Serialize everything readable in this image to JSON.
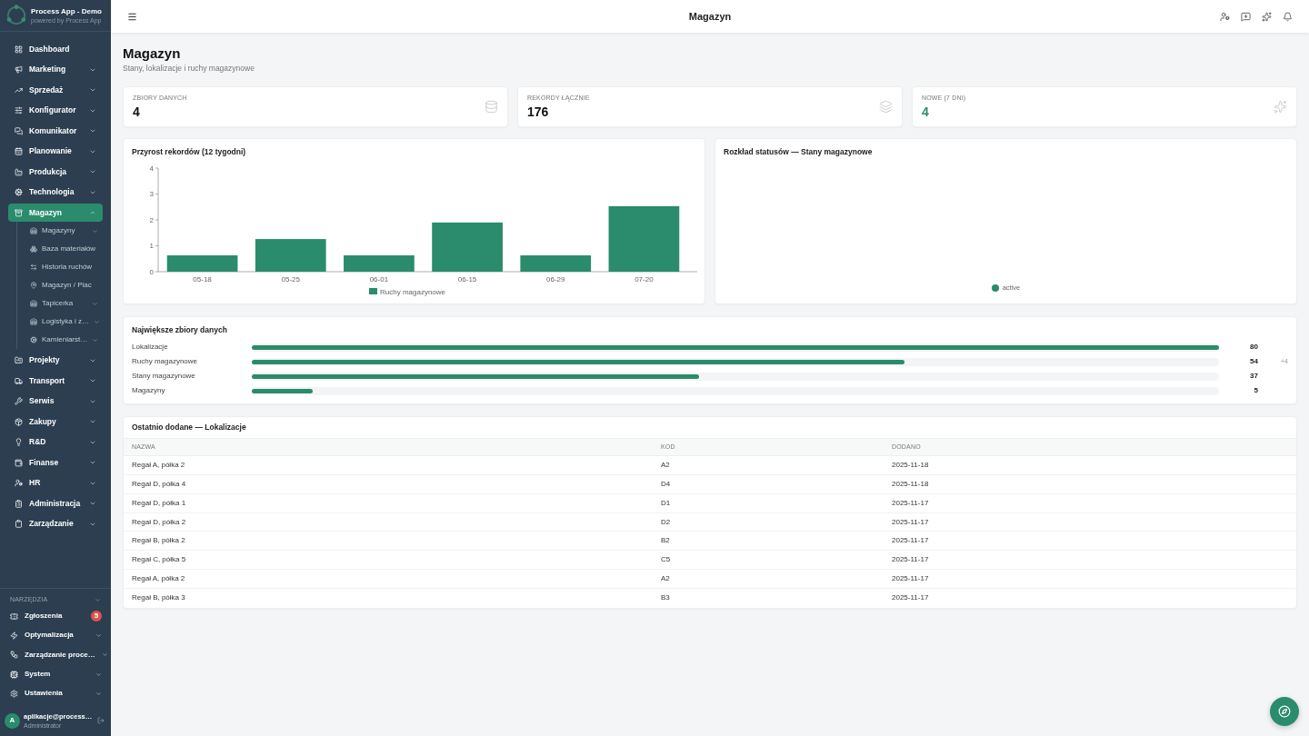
{
  "sidebar": {
    "brand": {
      "title": "Process App - Demo",
      "subtitle": "powered by Process App"
    },
    "items": [
      {
        "label": "Dashboard",
        "kind": "link",
        "selected": false
      },
      {
        "label": "Marketing",
        "kind": "group",
        "expanded": false,
        "selected": false
      },
      {
        "label": "Sprzedaż",
        "kind": "group",
        "expanded": false,
        "selected": false
      },
      {
        "label": "Konfigurator",
        "kind": "group",
        "expanded": false,
        "selected": false
      },
      {
        "label": "Komunikator",
        "kind": "group",
        "expanded": false,
        "selected": false
      },
      {
        "label": "Planowanie",
        "kind": "group",
        "expanded": false,
        "selected": false
      },
      {
        "label": "Produkcja",
        "kind": "group",
        "expanded": false,
        "selected": false
      },
      {
        "label": "Technologia",
        "kind": "group",
        "expanded": false,
        "selected": false
      },
      {
        "label": "Magazyn",
        "kind": "group",
        "expanded": true,
        "selected": true,
        "children": [
          {
            "label": "Magazyny",
            "kind": "group",
            "expanded": false,
            "selected": false
          },
          {
            "label": "Baza materiałów",
            "kind": "link",
            "selected": false
          },
          {
            "label": "Historia ruchów",
            "kind": "link",
            "selected": false
          },
          {
            "label": "Magazyn / Plac",
            "kind": "link",
            "selected": false
          },
          {
            "label": "Tapicerka",
            "kind": "group",
            "expanded": false,
            "selected": false
          },
          {
            "label": "Logistyka i z…",
            "kind": "group",
            "expanded": false,
            "selected": false
          },
          {
            "label": "Kamieniarst…",
            "kind": "group",
            "expanded": false,
            "selected": false
          }
        ]
      },
      {
        "label": "Projekty",
        "kind": "group",
        "expanded": false,
        "selected": false
      },
      {
        "label": "Transport",
        "kind": "group",
        "expanded": false,
        "selected": false
      },
      {
        "label": "Serwis",
        "kind": "group",
        "expanded": false,
        "selected": false
      },
      {
        "label": "Zakupy",
        "kind": "group",
        "expanded": false,
        "selected": false
      },
      {
        "label": "R&D",
        "kind": "group",
        "expanded": false,
        "selected": false
      },
      {
        "label": "Finanse",
        "kind": "group",
        "expanded": false,
        "selected": false
      },
      {
        "label": "HR",
        "kind": "group",
        "expanded": false,
        "selected": false
      },
      {
        "label": "Administracja",
        "kind": "group",
        "expanded": false,
        "selected": false
      },
      {
        "label": "Zarządzanie",
        "kind": "group",
        "expanded": false,
        "selected": false
      }
    ],
    "tools": {
      "title": "NARZĘDZIA",
      "items": [
        {
          "label": "Zgłoszenia",
          "kind": "link",
          "selected": false,
          "badge": "5"
        },
        {
          "label": "Optymalizacja",
          "kind": "group",
          "expanded": false,
          "selected": false
        },
        {
          "label": "Zarządzanie proce…",
          "kind": "group",
          "expanded": false,
          "selected": false
        },
        {
          "label": "System",
          "kind": "group",
          "expanded": false,
          "selected": false
        },
        {
          "label": "Ustawienia",
          "kind": "group",
          "expanded": false,
          "selected": false
        }
      ]
    },
    "user": {
      "initial": "A",
      "name": "aplikacje@process…",
      "role": "Administrator"
    }
  },
  "topbar": {
    "title": "Magazyn"
  },
  "page": {
    "title": "Magazyn",
    "subtitle": "Stany, lokalizacje i ruchy magazynowe"
  },
  "stats": [
    {
      "label": "ZBIORY DANYCH",
      "value": "4",
      "highlight": false
    },
    {
      "label": "REKORDY ŁĄCZNIE",
      "value": "176",
      "highlight": false
    },
    {
      "label": "NOWE (7 DNI)",
      "value": "4",
      "highlight": true
    }
  ],
  "growth_chart": {
    "title": "Przyrost rekordów (12 tygodni)",
    "chart_data": {
      "type": "bar",
      "categories": [
        "05-18",
        "05-25",
        "06-01",
        "06-15",
        "06-29",
        "07-20"
      ],
      "series": [
        {
          "name": "Ruchy magazynowe",
          "color": "#2a8c6c",
          "values": [
            0.63,
            1.26,
            0.63,
            1.9,
            0.63,
            2.53
          ]
        }
      ],
      "ylim": [
        0,
        4
      ],
      "yticks": [
        0,
        1,
        2,
        3,
        4
      ]
    }
  },
  "status_chart": {
    "title": "Rozkład statusów — Stany magazynowe",
    "legend": [
      {
        "label": "active",
        "color": "#2a8c6c"
      }
    ]
  },
  "largest_datasets": {
    "title": "Największe zbiory danych",
    "rows": [
      {
        "label": "Lokalizacje",
        "level": 1,
        "value": "80"
      },
      {
        "label": "Ruchy magazynowe",
        "level": 0.675,
        "value": "54",
        "note": "+4"
      },
      {
        "label": "Stany magazynowe",
        "level": 0.4625,
        "value": "37"
      },
      {
        "label": "Magazyny",
        "level": 0.0625,
        "value": "5"
      }
    ]
  },
  "recent": {
    "title": "Ostatnio dodane — Lokalizacje",
    "columns": [
      "NAZWA",
      "KOD",
      "DODANO"
    ],
    "rows": [
      [
        "Regał A, półka 2",
        "A2",
        "2025-11-18"
      ],
      [
        "Regał D, półka 4",
        "D4",
        "2025-11-18"
      ],
      [
        "Regał D, półka 1",
        "D1",
        "2025-11-17"
      ],
      [
        "Regał D, półka 2",
        "D2",
        "2025-11-17"
      ],
      [
        "Regał B, półka 2",
        "B2",
        "2025-11-17"
      ],
      [
        "Regał C, półka 5",
        "C5",
        "2025-11-17"
      ],
      [
        "Regał A, półka 2",
        "A2",
        "2025-11-17"
      ],
      [
        "Regał B, półka 3",
        "B3",
        "2025-11-17"
      ]
    ]
  }
}
